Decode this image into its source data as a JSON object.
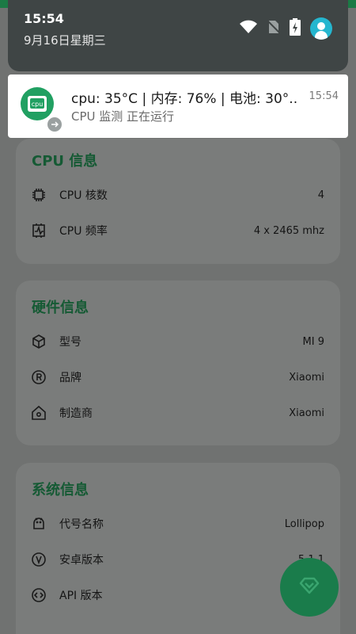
{
  "status_bar": {
    "time": "15:54",
    "date": "9月16日星期三",
    "icons": [
      "wifi-icon",
      "no-sim-icon",
      "battery-charging-icon",
      "account-avatar-icon"
    ]
  },
  "notification": {
    "app_icon": "cpu-monitor-app-icon",
    "title": "cpu: 35°C | 内存: 76% | 电池: 30°..",
    "subtitle": "CPU 监测 正在运行",
    "time": "15:54"
  },
  "sections": [
    {
      "title": "CPU 信息",
      "rows": [
        {
          "icon": "cpu-chip-icon",
          "label": "CPU 核数",
          "value": "4"
        },
        {
          "icon": "cpu-frequency-icon",
          "label": "CPU 频率",
          "value": "4 x 2465 mhz"
        }
      ]
    },
    {
      "title": "硬件信息",
      "rows": [
        {
          "icon": "cube-icon",
          "label": "型号",
          "value": "MI 9"
        },
        {
          "icon": "registered-icon",
          "label": "品牌",
          "value": "Xiaomi"
        },
        {
          "icon": "home-icon",
          "label": "制造商",
          "value": "Xiaomi"
        }
      ]
    },
    {
      "title": "系统信息",
      "rows": [
        {
          "icon": "android-icon",
          "label": "代号名称",
          "value": "Lollipop"
        },
        {
          "icon": "version-icon",
          "label": "安卓版本",
          "value": "5.1.1"
        },
        {
          "icon": "code-icon",
          "label": "API 版本",
          "value": ""
        }
      ]
    }
  ],
  "fab": {
    "icon": "diamond-chevron-icon"
  },
  "colors": {
    "accent": "#1a7c4b",
    "section_title": "#155a34",
    "shade": "#3f4545",
    "avatar": "#25b6cf"
  }
}
